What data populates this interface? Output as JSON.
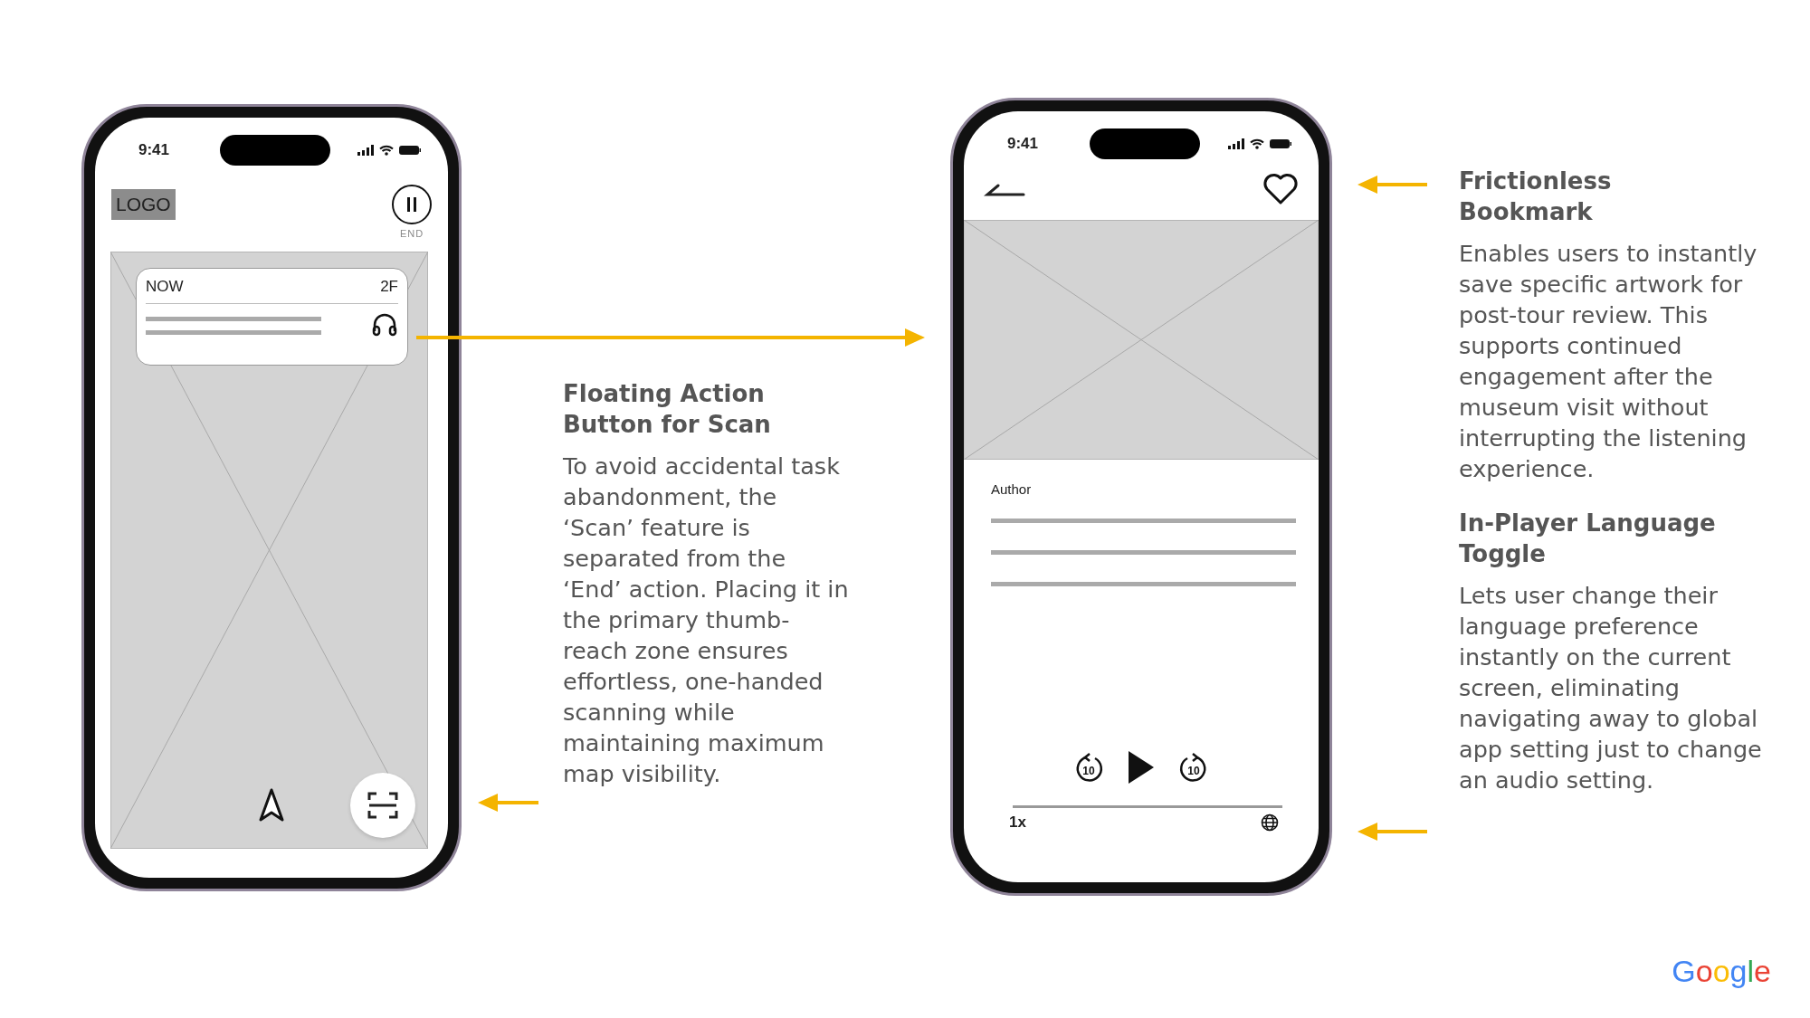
{
  "phones": [
    {
      "kind": "map",
      "status": {
        "time": "9:41"
      },
      "logo": "LOGO",
      "end_label": "END",
      "now_card": {
        "label": "NOW",
        "floor": "2F"
      }
    },
    {
      "kind": "player",
      "status": {
        "time": "9:41"
      },
      "author": "Author",
      "skip_back": "10",
      "skip_forward": "10",
      "speed": "1x"
    }
  ],
  "annotations": [
    {
      "title": "Floating Action Button for Scan",
      "body": "To avoid accidental task abandonment, the ‘Scan’ feature is separated from the ‘End’ action. Placing it in the primary thumb-reach zone ensures effortless, one-handed scanning while maintaining maximum map visibility."
    },
    {
      "title": "Frictionless Bookmark",
      "body": "Enables users to instantly save specific artwork for post-tour review. This supports continued engagement after the museum visit without interrupting the listening experience."
    },
    {
      "title": "In-Player Language Toggle",
      "body": "Lets user change their language preference instantly on the current screen, eliminating navigating away to global app setting just to change an audio setting."
    }
  ],
  "brand": "Google"
}
